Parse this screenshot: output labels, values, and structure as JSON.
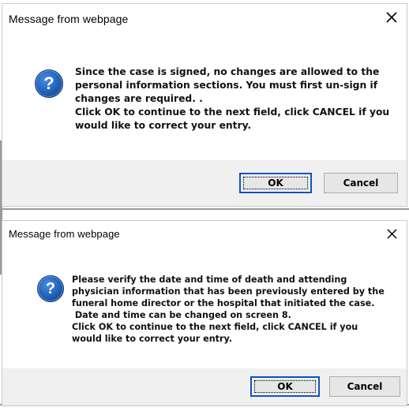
{
  "dialog1": {
    "title": "Message from webpage",
    "close_symbol": "✕",
    "icon": "question-icon",
    "icon_glyph": "?",
    "lines": [
      "Since the case is signed, no changes are allowed to the",
      "personal information sections.  You must first un-sign if",
      "changes are required.  .",
      "Click OK to continue to the next field, click CANCEL if you",
      "would like to correct your entry."
    ],
    "ok_label": "OK",
    "cancel_label": "Cancel"
  },
  "dialog2": {
    "title": "Message from webpage",
    "close_symbol": "✕",
    "icon": "question-icon",
    "icon_glyph": "?",
    "lines": [
      "Please verify the date and time of death and attending",
      "physician information that has been previously entered by the",
      "funeral home director or the hospital that initiated the case.",
      " Date and time can be changed on screen 8.",
      "Click OK to continue to the next field, click CANCEL if you",
      "would like to correct your entry."
    ],
    "ok_label": "OK",
    "cancel_label": "Cancel"
  },
  "colors": {
    "icon_blue": "#1d5fb5",
    "default_button_border": "#0a50c6",
    "footer_bg": "#f0f0f0"
  }
}
